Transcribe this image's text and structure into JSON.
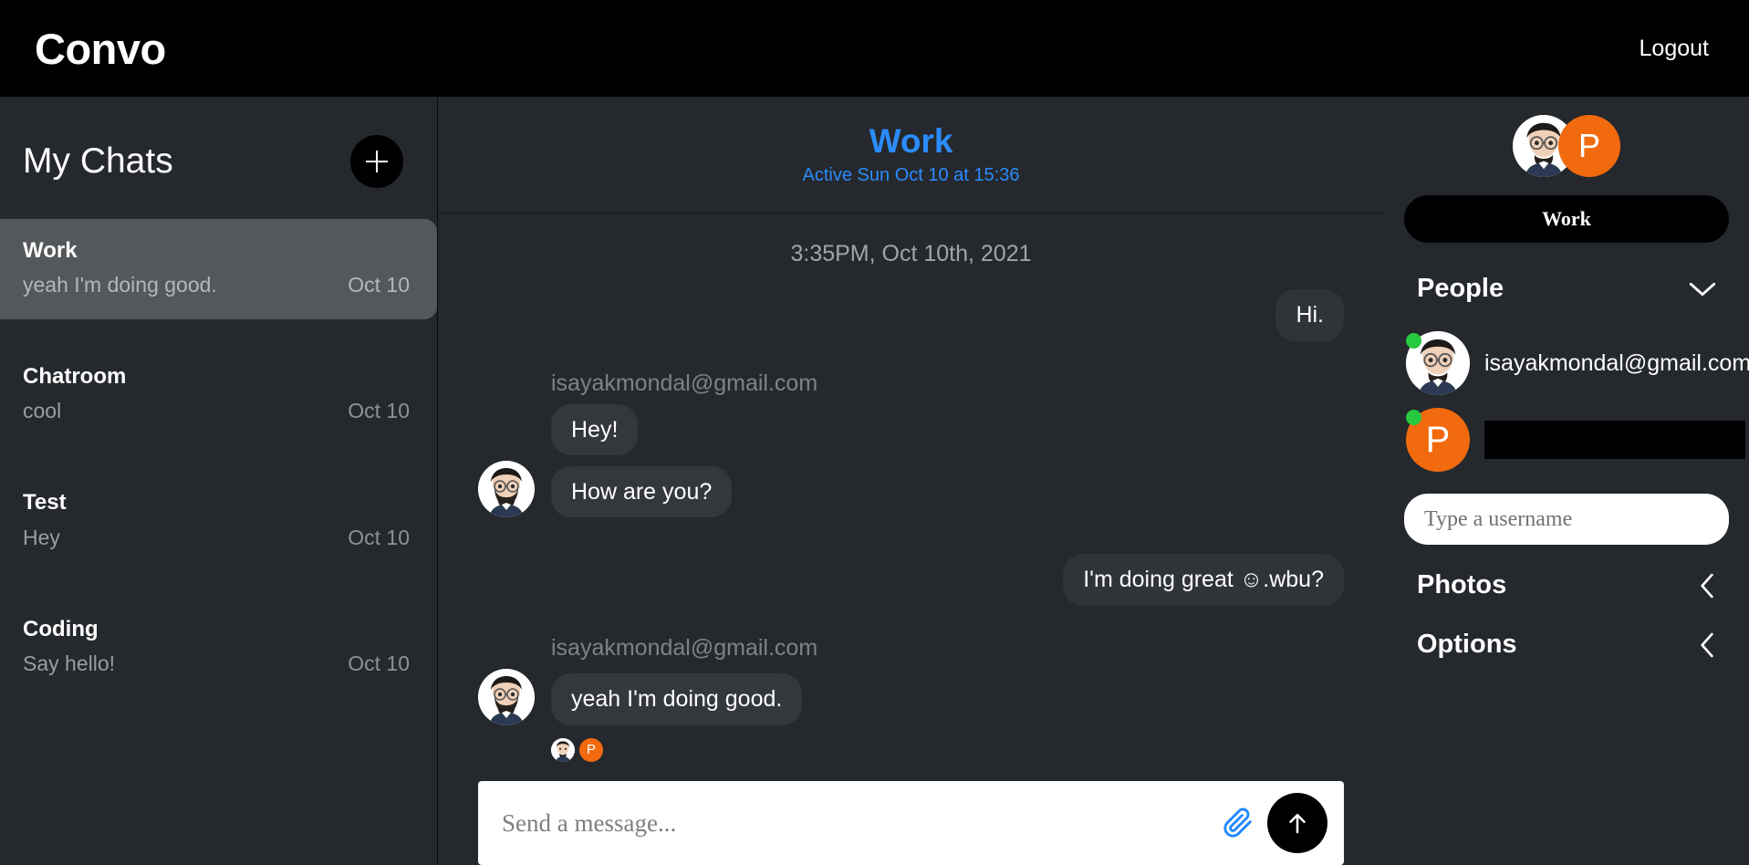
{
  "topbar": {
    "brand": "Convo",
    "logout_label": "Logout"
  },
  "sidebar": {
    "title": "My Chats",
    "add_button_label": "+",
    "chats": [
      {
        "name": "Work",
        "preview": "yeah I'm doing good.",
        "date": "Oct 10",
        "active": true
      },
      {
        "name": "Chatroom",
        "preview": "cool",
        "date": "Oct 10",
        "active": false
      },
      {
        "name": "Test",
        "preview": "Hey",
        "date": "Oct 10",
        "active": false
      },
      {
        "name": "Coding",
        "preview": "Say hello!",
        "date": "Oct 10",
        "active": false
      }
    ]
  },
  "chat": {
    "title": "Work",
    "status": "Active Sun Oct 10 at 15:36",
    "timestamp": "3:35PM, Oct 10th, 2021",
    "messages": [
      {
        "id": "m1",
        "side": "out",
        "text": "Hi.",
        "sender": null
      },
      {
        "id": "m2",
        "side": "in",
        "text": "Hey!",
        "sender": "isayakmondal@gmail.com"
      },
      {
        "id": "m3",
        "side": "in",
        "text": "How are you?",
        "sender": null
      },
      {
        "id": "m4",
        "side": "out",
        "text": "I'm doing great ☺.wbu?",
        "sender": null
      },
      {
        "id": "m5",
        "side": "in",
        "text": "yeah I'm doing good.",
        "sender": "isayakmondal@gmail.com"
      }
    ]
  },
  "composer": {
    "placeholder": "Send a message...",
    "value": "",
    "attach_icon": "paperclip-icon",
    "send_icon": "arrow-up-icon"
  },
  "right_panel": {
    "chip_label": "Work",
    "people_label": "People",
    "people": [
      {
        "name": "isayakmondal@gmail.com",
        "avatar": "photo",
        "online": true,
        "redacted": false
      },
      {
        "name": "",
        "avatar": "P",
        "online": true,
        "redacted": true
      }
    ],
    "username_placeholder": "Type a username",
    "photos_label": "Photos",
    "options_label": "Options",
    "people_chevron": "chevron-down-icon",
    "photos_chevron": "chevron-left-icon",
    "options_chevron": "chevron-left-icon"
  },
  "colors": {
    "accent_blue": "#2b8cfd",
    "accent_orange": "#f26a0e",
    "online_green": "#27c93f",
    "bg_dark": "#25282d",
    "black": "#000000"
  }
}
